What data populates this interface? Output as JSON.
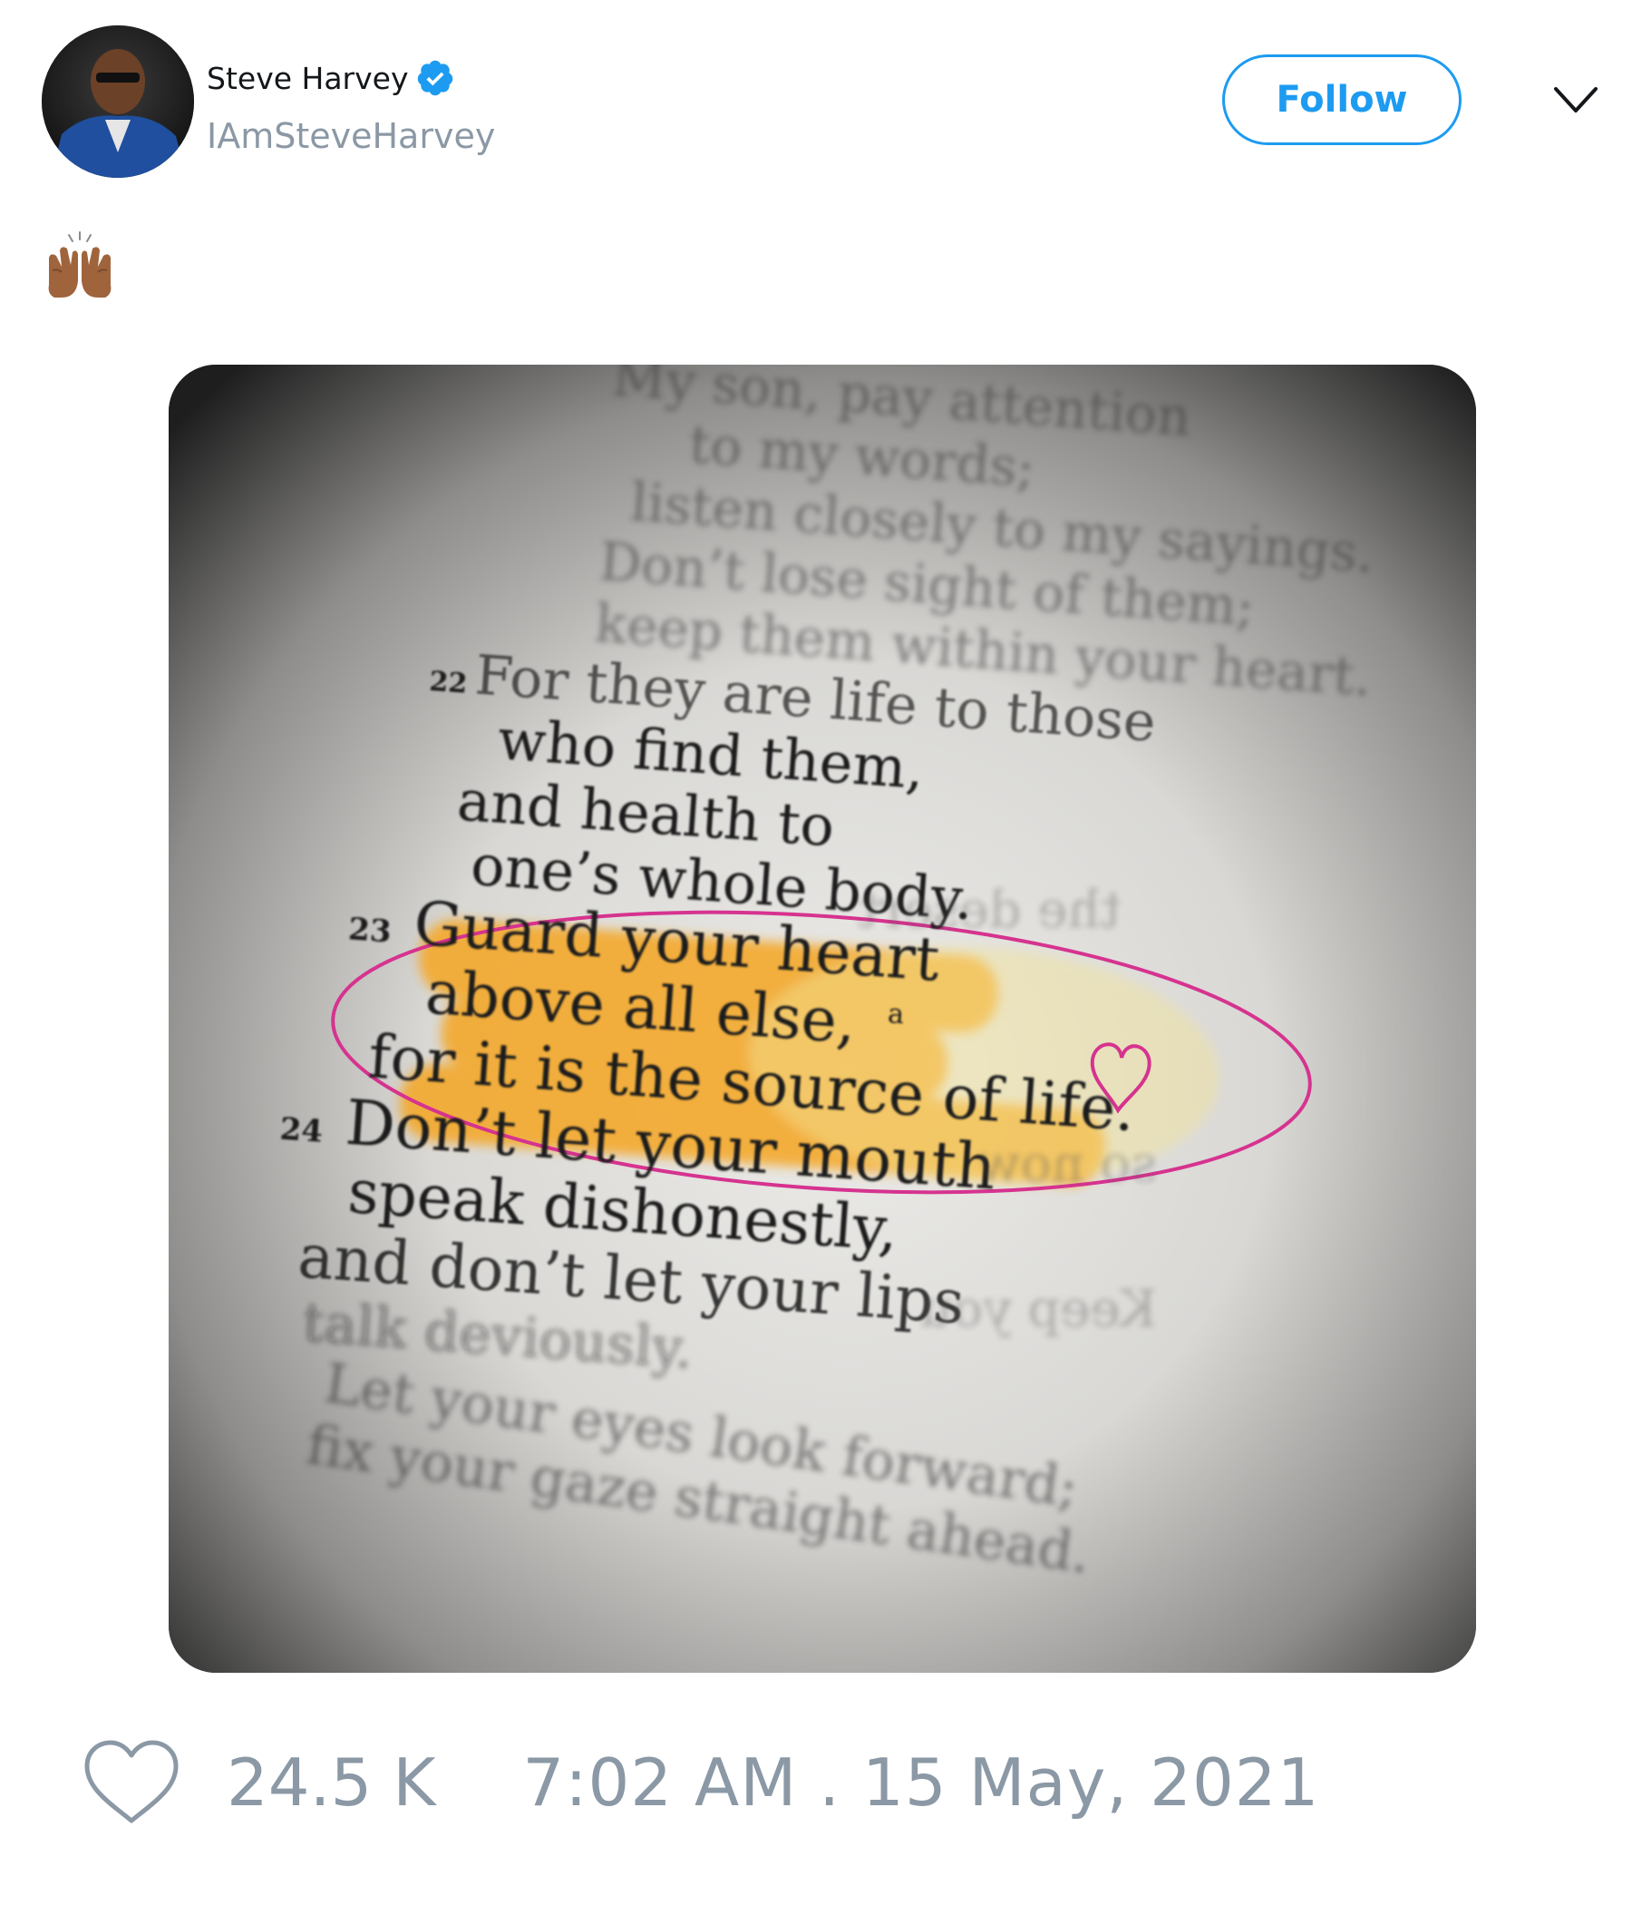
{
  "user": {
    "display_name": "Steve Harvey",
    "handle": "IAmSteveHarvey",
    "verified": true
  },
  "follow_button": {
    "label": "Follow"
  },
  "tweet": {
    "text_emoji": "raising-hands-medium-dark-skin-emoji",
    "media": {
      "verses": [
        {
          "number": "22",
          "text": "For they are life to those"
        },
        {
          "number": "",
          "text": "who find them,"
        },
        {
          "number": "",
          "text": "and health to"
        },
        {
          "number": "",
          "text": "one’s whole body."
        },
        {
          "number": "23",
          "text": "Guard your heart"
        },
        {
          "number": "",
          "text": "above all else,",
          "footnote": "a"
        },
        {
          "number": "",
          "text": "for it is the source of life."
        },
        {
          "number": "24",
          "text": "Don’t let your mouth"
        },
        {
          "number": "",
          "text": "speak dishonestly,"
        },
        {
          "number": "",
          "text": "and don’t let your lips"
        },
        {
          "number": "",
          "text": "talk deviously."
        }
      ],
      "faded_top": [
        "My son, pay attention",
        "to my words;",
        "listen closely to my sayings.",
        "Don’t lose sight of them;",
        "keep them within your heart."
      ],
      "faded_bottom": [
        "Let your eyes look forward;",
        "fix your gaze straight ahead."
      ],
      "highlight_color": "#f5a623",
      "circle_color": "#d6338f"
    }
  },
  "footer": {
    "like_count": "24.5 K",
    "timestamp": "7:02 AM . 15 May, 2021"
  },
  "colors": {
    "accent": "#1d9bf0",
    "muted": "#8b98a5"
  }
}
